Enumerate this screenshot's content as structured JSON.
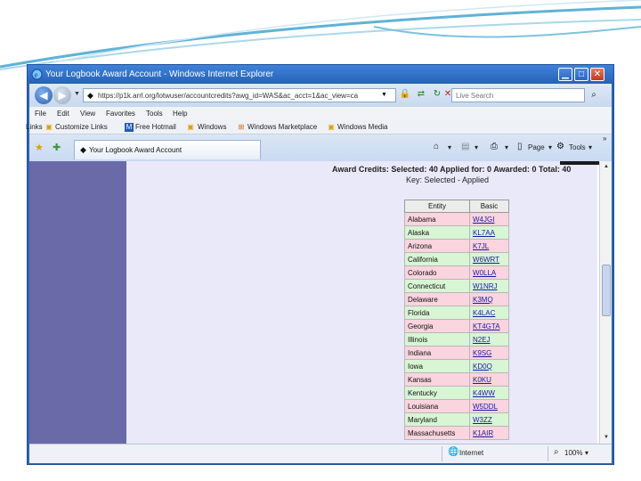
{
  "window": {
    "title": "Your Logbook Award Account - Windows Internet Explorer"
  },
  "address": {
    "url": "https://p1k.arrl.org/lotwuser/accountcredits?awg_id=WAS&ac_acct=1&ac_view=ca",
    "search_placeholder": "Live Search"
  },
  "menu": [
    "File",
    "Edit",
    "View",
    "Favorites",
    "Tools",
    "Help"
  ],
  "links_bar": {
    "label": "Links",
    "items": [
      "Customize Links",
      "Free Hotmail",
      "Windows",
      "Windows Marketplace",
      "Windows Media"
    ]
  },
  "tab": {
    "label": "Your Logbook Award Account"
  },
  "commands": {
    "page": "Page",
    "tools": "Tools"
  },
  "page": {
    "award_credits": "Award Credits: Selected: 40 Applied for: 0 Awarded: 0 Total: 40",
    "key": "Key:    Selected - Applied",
    "table": {
      "headers": [
        "Entity",
        "Basic"
      ],
      "rows": [
        {
          "entity": "Alabama",
          "call": "W4JGI",
          "status": "applied"
        },
        {
          "entity": "Alaska",
          "call": "KL7AA",
          "status": "selected"
        },
        {
          "entity": "Arizona",
          "call": "K7JL",
          "status": "applied"
        },
        {
          "entity": "California",
          "call": "W6WRT",
          "status": "selected"
        },
        {
          "entity": "Colorado",
          "call": "W0LLA",
          "status": "applied"
        },
        {
          "entity": "Connecticut",
          "call": "W1NRJ",
          "status": "selected"
        },
        {
          "entity": "Delaware",
          "call": "K3MQ",
          "status": "applied"
        },
        {
          "entity": "Florida",
          "call": "K4LAC",
          "status": "selected"
        },
        {
          "entity": "Georgia",
          "call": "KT4GTA",
          "status": "applied"
        },
        {
          "entity": "Illinois",
          "call": "N2EJ",
          "status": "selected"
        },
        {
          "entity": "Indiana",
          "call": "K9SG",
          "status": "applied"
        },
        {
          "entity": "Iowa",
          "call": "KD0Q",
          "status": "selected"
        },
        {
          "entity": "Kansas",
          "call": "K0KU",
          "status": "applied"
        },
        {
          "entity": "Kentucky",
          "call": "K4WW",
          "status": "selected"
        },
        {
          "entity": "Louisiana",
          "call": "W5DDL",
          "status": "applied"
        },
        {
          "entity": "Maryland",
          "call": "W3ZZ",
          "status": "selected"
        },
        {
          "entity": "Massachusetts",
          "call": "K1AIR",
          "status": "applied"
        }
      ]
    }
  },
  "status": {
    "zone": "Internet",
    "zoom": "100%"
  },
  "colors": {
    "applied_row": "#fad4de",
    "selected_row": "#d8f5d4",
    "sidebar": "#6a6aa8",
    "page_bg": "#e9e9fa"
  }
}
